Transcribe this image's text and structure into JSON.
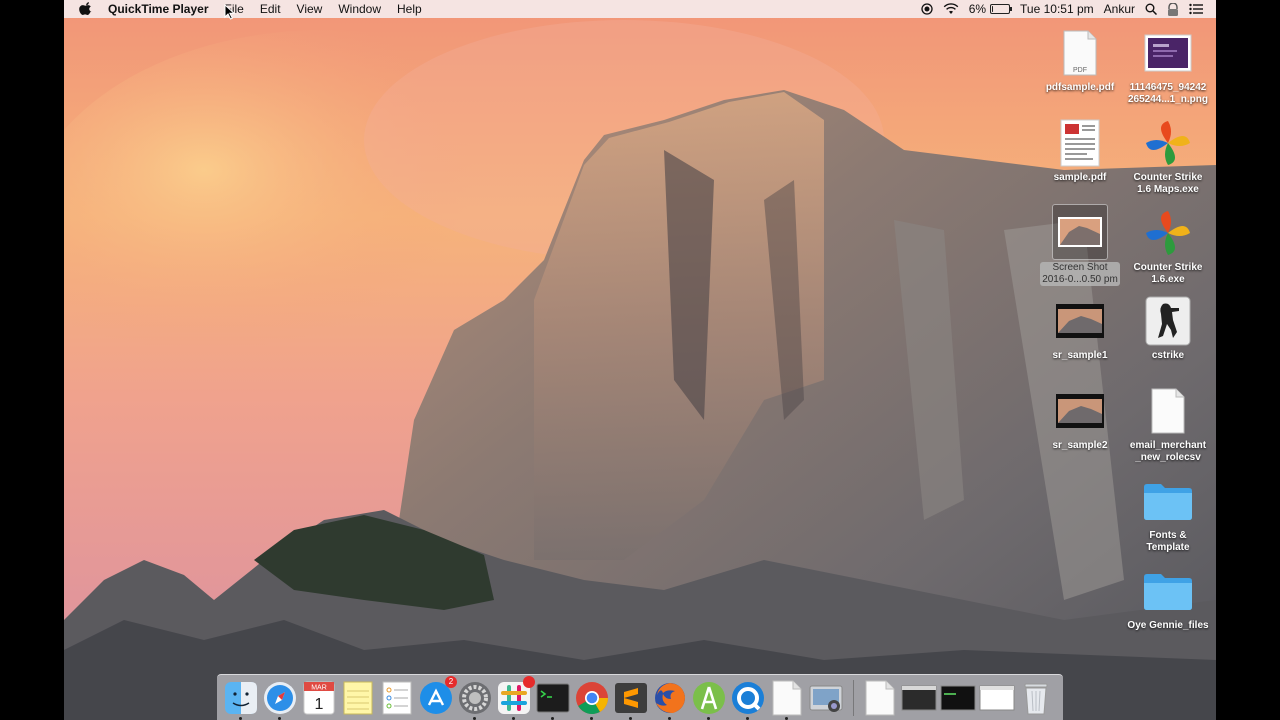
{
  "menubar": {
    "app_name": "QuickTime Player",
    "menus": [
      "File",
      "Edit",
      "View",
      "Window",
      "Help"
    ],
    "battery_percent": "6%",
    "battery_level": 0.06,
    "clock": "Tue 10:51 pm",
    "user": "Ankur",
    "icons": [
      "apple-icon",
      "record-icon",
      "wifi-icon",
      "battery-icon",
      "search-icon",
      "vault-icon",
      "list-icon"
    ]
  },
  "desktop": {
    "icons": [
      {
        "label": "pdfsample.pdf",
        "kind": "pdf-icon",
        "badge_text": "PDF"
      },
      {
        "label": "11146475_94242\n265244...1_n.png",
        "kind": "image-icon"
      },
      {
        "label": "sample.pdf",
        "kind": "pdf-document-icon"
      },
      {
        "label": "Counter Strike\n1.6 Maps.exe",
        "kind": "pinwheel-icon"
      },
      {
        "label": "Screen Shot\n2016-0...0.50 pm",
        "kind": "screenshot-icon",
        "selected": true
      },
      {
        "label": "Counter Strike\n1.6.exe",
        "kind": "pinwheel-icon"
      },
      {
        "label": "sr_sample1",
        "kind": "video-icon"
      },
      {
        "label": "cstrike",
        "kind": "cstrike-icon"
      },
      {
        "label": "sr_sample2",
        "kind": "video-icon"
      },
      {
        "label": "email_merchant\n_new_rolecsv",
        "kind": "file-icon"
      },
      {
        "label": "Fonts &\nTemplate",
        "kind": "folder-icon"
      },
      {
        "label": "Oye Gennie_files",
        "kind": "folder-icon"
      }
    ]
  },
  "dock": {
    "calendar_month": "MAR",
    "calendar_day": "1",
    "app_store_badge": "2",
    "apps": [
      "finder",
      "safari",
      "calendar",
      "notes",
      "reminders",
      "app-store",
      "system-preferences",
      "slack",
      "terminal",
      "chrome",
      "sublime-text",
      "firefox",
      "android-studio",
      "quicktime",
      "preview-document",
      "image-capture"
    ],
    "stacks": [
      "document-stack",
      "window-1",
      "window-2",
      "window-3",
      "trash"
    ]
  },
  "colors": {
    "menubar_bg": "#f5eaec",
    "folder": "#5bb6ef",
    "badge": "#e62b2b"
  }
}
